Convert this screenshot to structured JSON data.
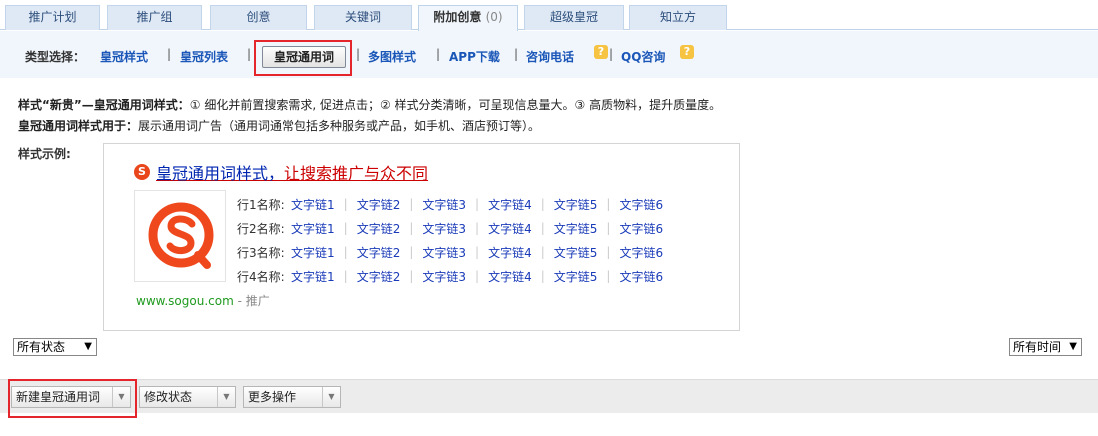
{
  "tabs": [
    {
      "label": "推广计划"
    },
    {
      "label": "推广组"
    },
    {
      "label": "创意"
    },
    {
      "label": "关键词"
    },
    {
      "label": "附加创意",
      "count": "(0)",
      "active": true
    },
    {
      "label": "超级皇冠"
    },
    {
      "label": "知立方"
    }
  ],
  "typebar": {
    "label": "类型选择：",
    "items": [
      "皇冠样式",
      "皇冠列表",
      "皇冠通用词",
      "多图样式",
      "APP下载",
      "咨询电话",
      "QQ咨询"
    ],
    "help": "?"
  },
  "desc": {
    "line1_bold": "样式“新贵”—皇冠通用词样式：",
    "line1_text": "① 细化并前置搜索需求, 促进点击；② 样式分类清晰，可呈现信息量大。③ 高质物料，提升质量度。",
    "line2_bold": "皇冠通用词样式用于：",
    "line2_text": "展示通用词广告（通用词通常包括多种服务或产品，如手机、酒店预订等）。"
  },
  "sample": {
    "label": "样式示例:",
    "logo_glyph": "S",
    "title_main": "皇冠通用词样式，",
    "title_rest": "让搜索推广与众不同",
    "rows": [
      "行1名称:",
      "行2名称:",
      "行3名称:",
      "行4名称:"
    ],
    "links": [
      "文字链1",
      "文字链2",
      "文字链3",
      "文字链4",
      "文字链5",
      "文字链6"
    ],
    "url": "www.sogou.com",
    "ad_tag": " - 推广"
  },
  "filters": {
    "status": "所有状态",
    "time": "所有时间",
    "arrow": "▼"
  },
  "actions": {
    "new": "新建皇冠通用词",
    "modify": "修改状态",
    "more": "更多操作",
    "arrow": "▼"
  },
  "colors": {
    "tab_bg": "#dfe9f5",
    "link_blue": "#1a56b8",
    "highlight_red": "#e4252b",
    "sogou_orange": "#e9461c"
  }
}
